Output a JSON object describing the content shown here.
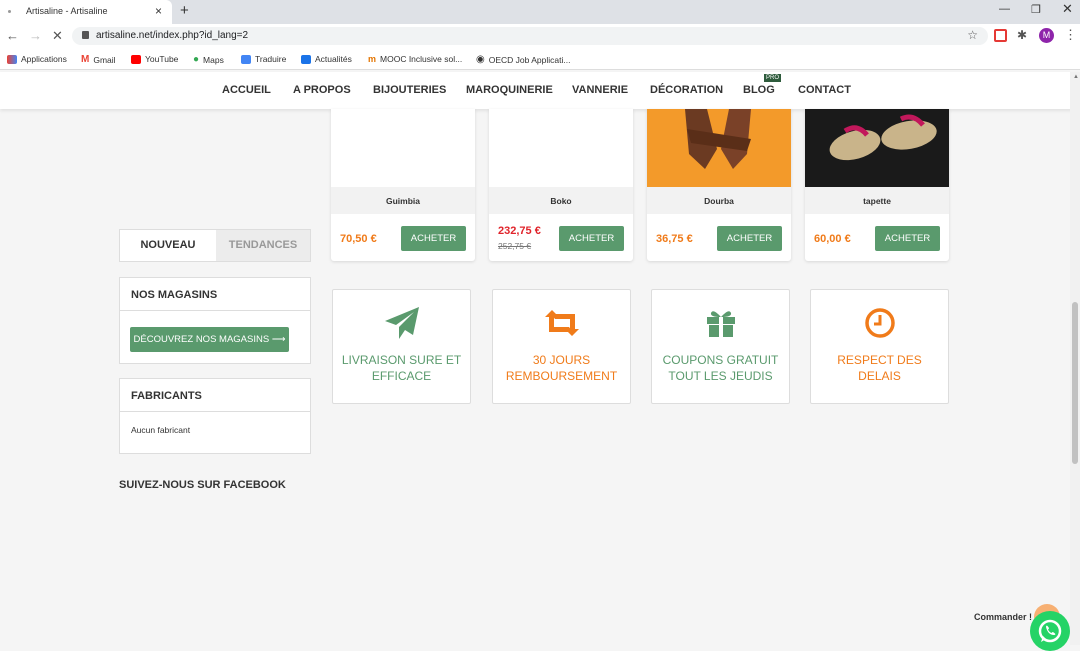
{
  "browser": {
    "tab_title": "Artisaline - Artisaline",
    "url": "artisaline.net/index.php?id_lang=2",
    "avatar_letter": "M",
    "bookmarks": [
      "Applications",
      "Gmail",
      "YouTube",
      "Maps",
      "Traduire",
      "Actualités",
      "MOOC Inclusive sol...",
      "OECD Job Applicati..."
    ]
  },
  "nav": {
    "items": [
      "ACCUEIL",
      "A PROPOS",
      "BIJOUTERIES",
      "MAROQUINERIE",
      "VANNERIE",
      "DÉCORATION",
      "BLOG",
      "CONTACT"
    ],
    "blog_badge": "PRO"
  },
  "products": [
    {
      "name": "Guimbia",
      "price": "70,50 €",
      "old_price": null,
      "buy_label": "ACHETER"
    },
    {
      "name": "Boko",
      "price": "232,75 €",
      "old_price": "252,75 €",
      "buy_label": "ACHETER"
    },
    {
      "name": "Dourba",
      "price": "36,75 €",
      "old_price": null,
      "buy_label": "ACHETER"
    },
    {
      "name": "tapette",
      "price": "60,00 €",
      "old_price": null,
      "buy_label": "ACHETER"
    }
  ],
  "features": [
    {
      "text": "LIVRAISON SURE ET EFFICACE",
      "color": "#5a9a6d",
      "icon": "paper-plane-icon"
    },
    {
      "text": "30 JOURS REMBOURSEMENT",
      "color": "#f07b1a",
      "icon": "retweet-icon"
    },
    {
      "text": "COUPONS GRATUIT TOUT LES JEUDIS",
      "color": "#5a9a6d",
      "icon": "gift-icon"
    },
    {
      "text": "RESPECT DES DELAIS",
      "color": "#f07b1a",
      "icon": "clock-icon"
    }
  ],
  "sidebar": {
    "tab_new": "NOUVEAU",
    "tab_trends": "TENDANCES",
    "shops_title": "NOS MAGASINS",
    "shops_button": "DÉCOUVREZ NOS MAGASINS ⟶",
    "brands_title": "FABRICANTS",
    "brands_text": "Aucun fabricant",
    "facebook_title": "SUIVEZ-NOUS SUR FACEBOOK"
  },
  "chat": {
    "label": "Commander !"
  }
}
